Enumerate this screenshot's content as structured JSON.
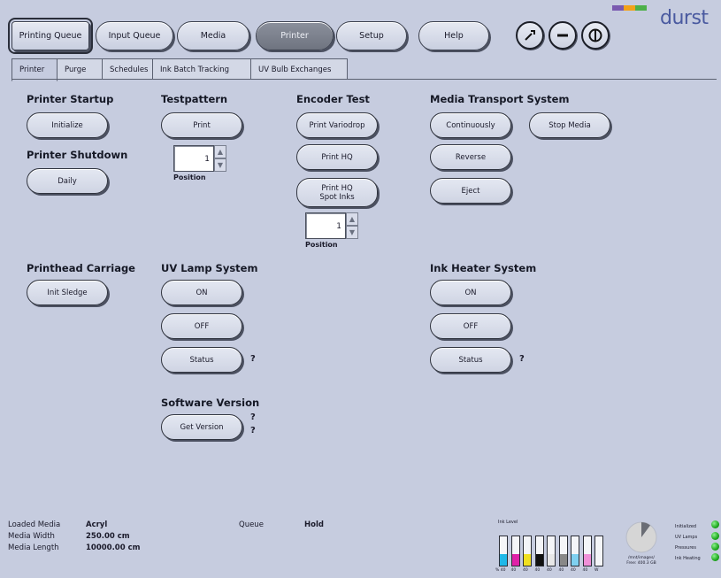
{
  "nav": {
    "printing_queue": "Printing Queue",
    "input_queue": "Input Queue",
    "media": "Media",
    "printer": "Printer",
    "setup": "Setup",
    "help": "Help"
  },
  "icons": {
    "tool": "wrench-icon",
    "minimize": "minus-icon",
    "power": "power-icon"
  },
  "logo": {
    "text": "durst",
    "colors": [
      "#7a5ab0",
      "#f2a21a",
      "#4db04a"
    ]
  },
  "tabs": [
    "Printer",
    "Purge",
    "Schedules",
    "Ink Batch Tracking",
    "UV Bulb Exchanges"
  ],
  "sections": {
    "printer_startup": {
      "title": "Printer Startup",
      "button": "Initialize"
    },
    "printer_shutdown": {
      "title": "Printer Shutdown",
      "button": "Daily"
    },
    "testpattern": {
      "title": "Testpattern",
      "button": "Print",
      "position_value": "1",
      "position_label": "Position"
    },
    "encoder_test": {
      "title": "Encoder Test",
      "print_variodrop": "Print Variodrop",
      "print_hq": "Print HQ",
      "print_hq_spot_line1": "Print HQ",
      "print_hq_spot_line2": "Spot Inks",
      "position_value": "1",
      "position_label": "Position"
    },
    "media_transport": {
      "title": "Media Transport System",
      "continuously": "Continuously",
      "stop_media": "Stop Media",
      "reverse": "Reverse",
      "eject": "Eject"
    },
    "printhead_carriage": {
      "title": "Printhead Carriage",
      "button": "Init Sledge"
    },
    "uv_lamp": {
      "title": "UV Lamp System",
      "on": "ON",
      "off": "OFF",
      "status": "Status",
      "status_value": "?"
    },
    "ink_heater": {
      "title": "Ink Heater System",
      "on": "ON",
      "off": "OFF",
      "status": "Status",
      "status_value": "?"
    },
    "software_version": {
      "title": "Software Version",
      "button": "Get Version",
      "value1": "?",
      "value2": "?"
    }
  },
  "status": {
    "loaded_media_label": "Loaded Media",
    "loaded_media": "Acryl",
    "media_width_label": "Media Width",
    "media_width": "250.00 cm",
    "media_length_label": "Media Length",
    "media_length": "10000.00 cm",
    "queue_label": "Queue",
    "queue_value": "Hold",
    "ink_level_title": "Ink Level",
    "ink_levels": [
      {
        "color": "#1fb8e8",
        "level": 0.4
      },
      {
        "color": "#e020a8",
        "level": 0.4
      },
      {
        "color": "#f0e020",
        "level": 0.4
      },
      {
        "color": "#111111",
        "level": 0.4
      },
      {
        "color": "#e8e8e8",
        "level": 0.4
      },
      {
        "color": "#888888",
        "level": 0.4
      },
      {
        "color": "#7fd0f0",
        "level": 0.4
      },
      {
        "color": "#f090d8",
        "level": 0.4
      },
      {
        "color": "#ffffff",
        "level": 0.0
      }
    ],
    "ink_scale_labels": [
      "% 40",
      "40",
      "40",
      "40",
      "40",
      "40",
      "40",
      "40",
      "W"
    ],
    "disk_path": "/mnt/images/",
    "disk_free": "Free: 400.3 GB",
    "indicators": [
      "Initialized",
      "UV Lamps",
      "Pressures",
      "Ink Heating"
    ]
  }
}
